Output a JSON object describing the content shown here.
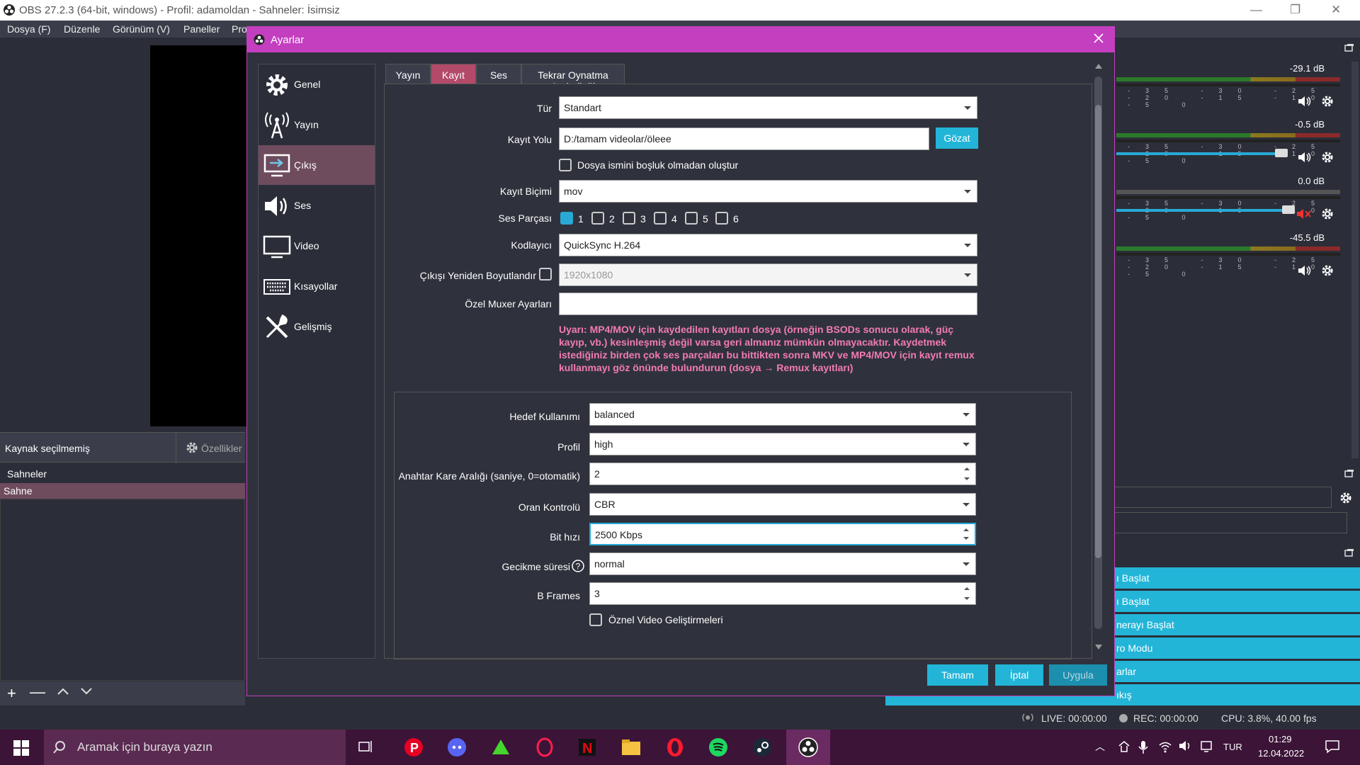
{
  "window": {
    "title": "OBS 27.2.3 (64-bit, windows) - Profil: adamoldan - Sahneler: İsimsiz"
  },
  "menu": [
    "Dosya (F)",
    "Düzenle",
    "Görünüm (V)",
    "Paneller",
    "Pro"
  ],
  "sources": {
    "none_selected": "Kaynak seçilmemiş",
    "properties": "Özellikler"
  },
  "scenes": {
    "header": "Sahneler",
    "items": [
      "Sahne"
    ]
  },
  "mixer": [
    {
      "db": "-29.1 dB",
      "slider": 0.0,
      "muted": false
    },
    {
      "db": "-0.5 dB",
      "slider": 0.95,
      "muted": false
    },
    {
      "db": "0.0 dB",
      "slider": 0.95,
      "muted": true
    },
    {
      "db": "-45.5 dB",
      "slider": 0.0,
      "muted": false
    }
  ],
  "meter_ticks": "-35 -30 -25 -20 -15 -10 -5 0",
  "controls": [
    "ı Başlat",
    "ı Başlat",
    "nerayı Başlat",
    "ro Modu",
    "arlar",
    "ıkış"
  ],
  "status": {
    "live": "LIVE: 00:00:00",
    "rec": "REC: 00:00:00",
    "cpu": "CPU: 3.8%, 40.00 fps"
  },
  "taskbar": {
    "search_placeholder": "Aramak için buraya yazın",
    "lang": "TUR",
    "time": "01:29",
    "date": "12.04.2022"
  },
  "dialog": {
    "title": "Ayarlar",
    "nav": [
      {
        "label": "Genel",
        "icon": "gear-icon"
      },
      {
        "label": "Yayın",
        "icon": "antenna-icon"
      },
      {
        "label": "Çıkış",
        "icon": "output-icon"
      },
      {
        "label": "Ses",
        "icon": "speaker-icon"
      },
      {
        "label": "Video",
        "icon": "monitor-icon"
      },
      {
        "label": "Kısayollar",
        "icon": "keyboard-icon"
      },
      {
        "label": "Gelişmiş",
        "icon": "tools-icon"
      }
    ],
    "nav_selected": 2,
    "tabs": [
      "Yayın",
      "Kayıt",
      "Ses",
      "Tekrar Oynatma Arabelleği"
    ],
    "tab_selected": 1,
    "fields": {
      "type_label": "Tür",
      "type_value": "Standart",
      "path_label": "Kayıt Yolu",
      "path_value": "D:/tamam videolar/öleee",
      "browse": "Gözat",
      "nospace_label": "Dosya ismini boşluk olmadan oluştur",
      "format_label": "Kayıt Biçimi",
      "format_value": "mov",
      "tracks_label": "Ses Parçası",
      "tracks": [
        "1",
        "2",
        "3",
        "4",
        "5",
        "6"
      ],
      "tracks_checked": [
        true,
        false,
        false,
        false,
        false,
        false
      ],
      "encoder_label": "Kodlayıcı",
      "encoder_value": "QuickSync H.264",
      "rescale_label": "Çıkışı Yeniden Boyutlandır",
      "rescale_value": "1920x1080",
      "muxer_label": "Özel Muxer Ayarları",
      "muxer_value": "",
      "warning": "Uyarı: MP4/MOV için kaydedilen kayıtları dosya (örneğin BSODs sonucu olarak, güç kayıp, vb.) kesinleşmiş değil varsa geri almanız mümkün olmayacaktır. Kaydetmek istediğiniz birden çok ses parçaları bu bittikten sonra MKV ve MP4/MOV için kayıt remux kullanmayı göz önünde bulundurun (dosya → Remux kayıtları)"
    },
    "encoder": {
      "target_label": "Hedef Kullanımı",
      "target_value": "balanced",
      "profile_label": "Profil",
      "profile_value": "high",
      "keyint_label": "Anahtar Kare Aralığı (saniye, 0=otomatik)",
      "keyint_value": "2",
      "rate_label": "Oran Kontrolü",
      "rate_value": "CBR",
      "bitrate_label": "Bit hızı",
      "bitrate_value": "2500 Kbps",
      "latency_label": "Gecikme süresi",
      "latency_value": "normal",
      "bframes_label": "B Frames",
      "bframes_value": "3",
      "enhance_label": "Öznel Video Geliştirmeleri"
    },
    "buttons": {
      "ok": "Tamam",
      "cancel": "İptal",
      "apply": "Uygula"
    }
  },
  "colors": {
    "accent": "#22b5d8",
    "dialog_title": "#c43ec0",
    "warning": "#f27bb3",
    "selected": "#6e4c5e",
    "tab_selected": "#b34a6a"
  }
}
